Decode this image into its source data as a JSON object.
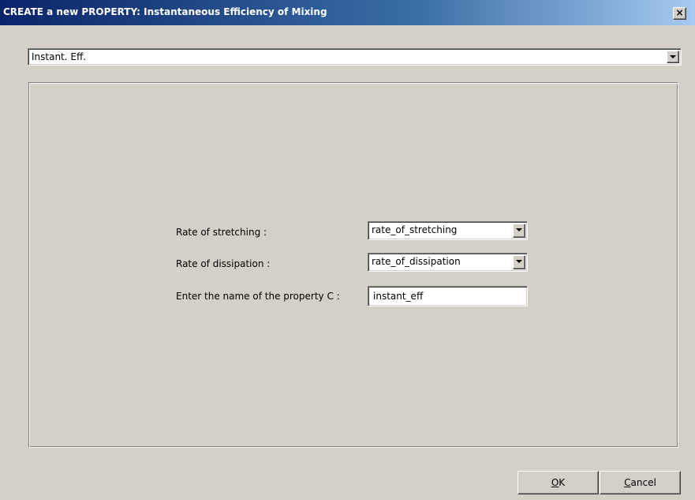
{
  "window": {
    "title": "CREATE a new PROPERTY: Instantaneous Efficiency of Mixing",
    "close_label": "×"
  },
  "property_type": {
    "selected": "Instant. Eff."
  },
  "form": {
    "rate_of_stretching": {
      "label": "Rate of stretching :",
      "selected": "rate_of_stretching"
    },
    "rate_of_dissipation": {
      "label": "Rate of dissipation :",
      "selected": "rate_of_dissipation"
    },
    "property_name": {
      "label": "Enter the name of the property C :",
      "value": "instant_eff"
    }
  },
  "buttons": {
    "ok": {
      "mnemonic": "O",
      "rest": "K"
    },
    "cancel": {
      "mnemonic": "C",
      "rest": "ancel"
    }
  },
  "colors": {
    "face": "#d4d0c8",
    "title_start": "#0a246a",
    "title_end": "#a6caf0"
  }
}
